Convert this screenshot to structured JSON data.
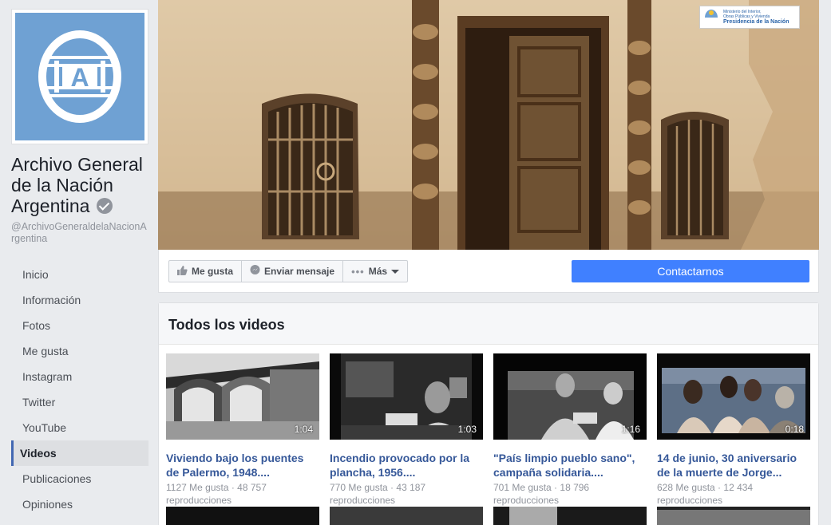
{
  "page": {
    "name": "Archivo General de la Nación Argentina",
    "handle": "@ArchivoGeneraldelaNacionArgentina",
    "logo_letter": "A"
  },
  "nav": [
    {
      "label": "Inicio",
      "name": "nav-inicio",
      "active": false
    },
    {
      "label": "Información",
      "name": "nav-informacion",
      "active": false
    },
    {
      "label": "Fotos",
      "name": "nav-fotos",
      "active": false
    },
    {
      "label": "Me gusta",
      "name": "nav-me-gusta",
      "active": false
    },
    {
      "label": "Instagram",
      "name": "nav-instagram",
      "active": false
    },
    {
      "label": "Twitter",
      "name": "nav-twitter",
      "active": false
    },
    {
      "label": "YouTube",
      "name": "nav-youtube",
      "active": false
    },
    {
      "label": "Videos",
      "name": "nav-videos",
      "active": true
    },
    {
      "label": "Publicaciones",
      "name": "nav-publicaciones",
      "active": false
    },
    {
      "label": "Opiniones",
      "name": "nav-opiniones",
      "active": false
    }
  ],
  "cover": {
    "gov_logo_line1": "Ministerio del Interior,",
    "gov_logo_line2": "Obras Públicas y Vivienda",
    "gov_logo_line3": "Presidencia de la Nación"
  },
  "actions": {
    "like": "Me gusta",
    "message": "Enviar mensaje",
    "more": "Más",
    "contact": "Contactarnos"
  },
  "videos": {
    "title": "Todos los videos",
    "items": [
      {
        "title": "Viviendo bajo los puentes de Palermo, 1948....",
        "duration": "1:04",
        "likes": "1127 Me gusta",
        "views": "48 757",
        "views_label": "reproducciones"
      },
      {
        "title": "Incendio provocado por la plancha, 1956....",
        "duration": "1:03",
        "likes": "770 Me gusta",
        "views": "43 187",
        "views_label": "reproducciones"
      },
      {
        "title": "\"País limpio pueblo sano\", campaña solidaria....",
        "duration": "1:16",
        "likes": "701 Me gusta",
        "views": "18 796",
        "views_label": "reproducciones"
      },
      {
        "title": "14 de junio, 30 aniversario de la muerte de Jorge...",
        "duration": "0:18",
        "likes": "628 Me gusta",
        "views": "12 434",
        "views_label": "reproducciones"
      }
    ]
  },
  "colors": {
    "accent": "#4080ff",
    "link": "#365899",
    "logo_bg": "#6fa1d3",
    "nav_active_border": "#4267b2"
  },
  "icons": {
    "like": "thumbs-up-icon",
    "message": "messenger-icon",
    "more": "ellipsis-icon",
    "verified": "verified-badge-icon"
  }
}
